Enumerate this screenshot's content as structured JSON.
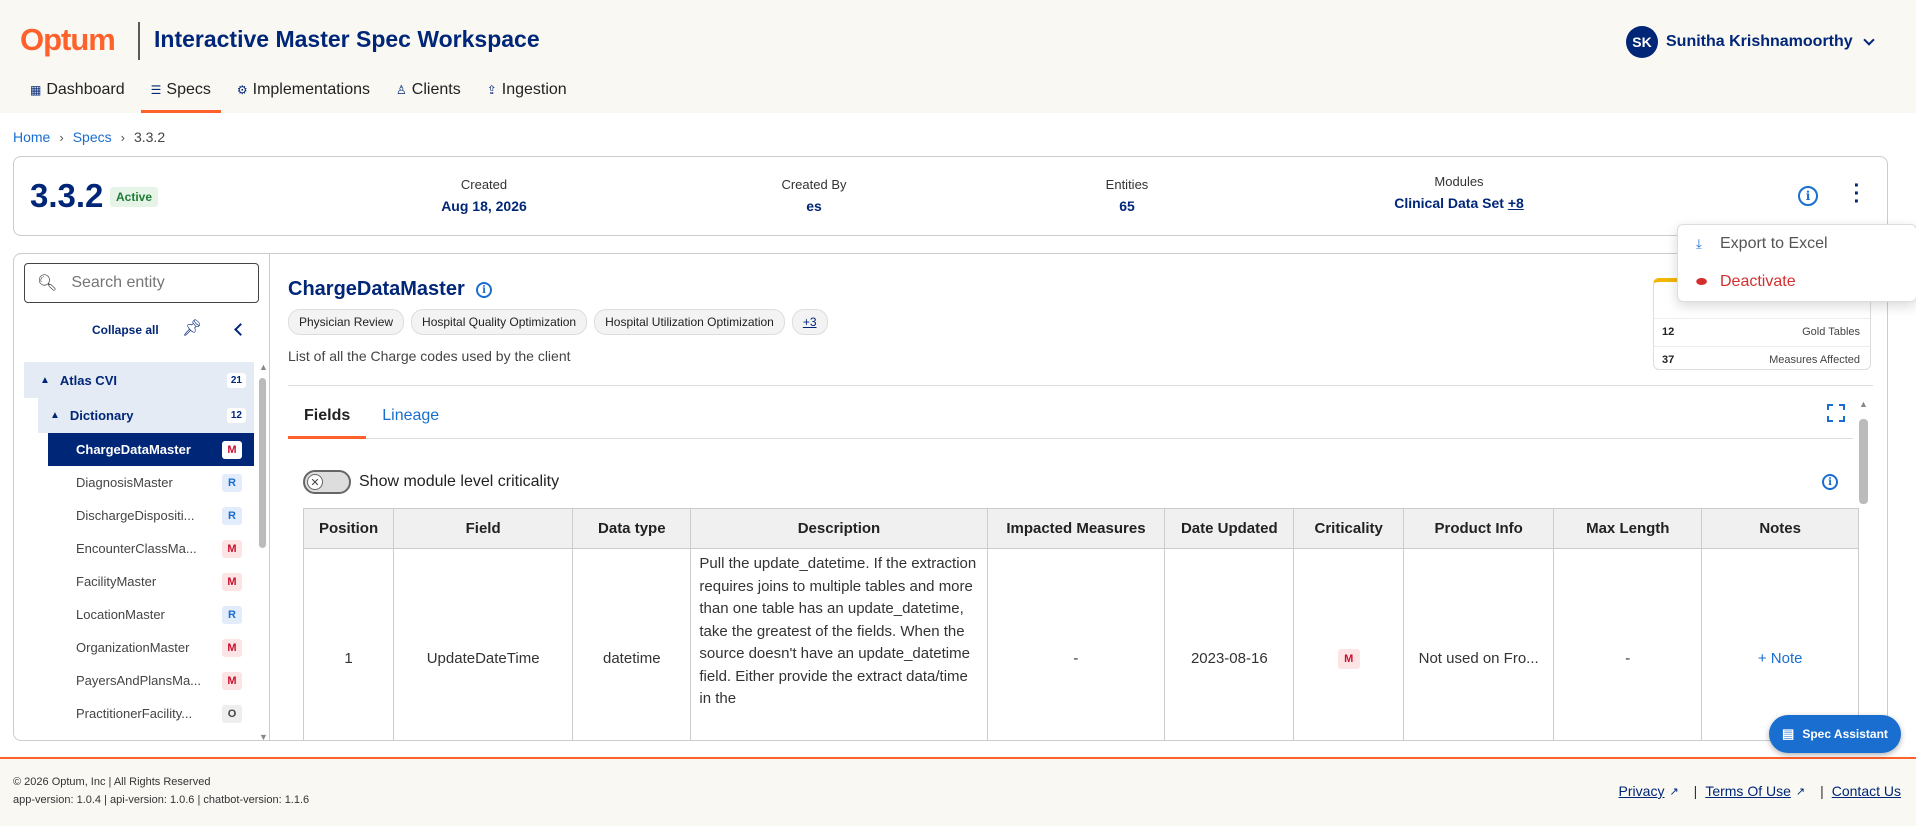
{
  "header": {
    "logo": "Optum",
    "app_title": "Interactive Master Spec Workspace",
    "user": {
      "initials": "SK",
      "name": "Sunitha Krishnamoorthy"
    }
  },
  "nav": {
    "items": [
      {
        "label": "Dashboard",
        "icon": "dashboard-icon"
      },
      {
        "label": "Specs",
        "icon": "database-icon",
        "active": true
      },
      {
        "label": "Implementations",
        "icon": "gear-icon"
      },
      {
        "label": "Clients",
        "icon": "user-icon"
      },
      {
        "label": "Ingestion",
        "icon": "upload-icon"
      }
    ]
  },
  "breadcrumb": [
    "Home",
    "Specs",
    "3.3.2"
  ],
  "spec": {
    "version": "3.3.2",
    "status": "Active",
    "created_label": "Created",
    "created_value": "Aug 18, 2026",
    "created_by_label": "Created By",
    "created_by_value": "es",
    "entities_label": "Entities",
    "entities_value": "65",
    "modules_label": "Modules",
    "modules_value": "Clinical Data Set",
    "modules_more": "+8"
  },
  "menu": {
    "export": "Export to Excel",
    "deactivate": "Deactivate"
  },
  "sidebar": {
    "search_placeholder": "Search entity",
    "collapse_label": "Collapse all",
    "group": {
      "label": "Atlas CVI",
      "count": "21"
    },
    "subgroup": {
      "label": "Dictionary",
      "count": "12"
    },
    "items": [
      {
        "label": "ChargeDataMaster",
        "badge": "M"
      },
      {
        "label": "DiagnosisMaster",
        "badge": "R"
      },
      {
        "label": "DischargeDispositi...",
        "badge": "R"
      },
      {
        "label": "EncounterClassMa...",
        "badge": "M"
      },
      {
        "label": "FacilityMaster",
        "badge": "M"
      },
      {
        "label": "LocationMaster",
        "badge": "R"
      },
      {
        "label": "OrganizationMaster",
        "badge": "M"
      },
      {
        "label": "PayersAndPlansMa...",
        "badge": "M"
      },
      {
        "label": "PractitionerFacility...",
        "badge": "O"
      }
    ]
  },
  "entity": {
    "name": "ChargeDataMaster",
    "tags": [
      "Physician Review",
      "Hospital Quality Optimization",
      "Hospital Utilization Optimization"
    ],
    "tags_more": "+3",
    "description": "List of all the Charge codes used by the client",
    "stats": [
      {
        "value": "12",
        "label": "Gold Tables"
      },
      {
        "value": "37",
        "label": "Measures Affected"
      }
    ]
  },
  "tabs": [
    "Fields",
    "Lineage"
  ],
  "toggle_label": "Show module level criticality",
  "table": {
    "columns": [
      "Position",
      "Field",
      "Data type",
      "Description",
      "Impacted Measures",
      "Date Updated",
      "Criticality",
      "Product Info",
      "Max Length",
      "Notes"
    ],
    "rows": [
      {
        "position": "1",
        "field": "UpdateDateTime",
        "datatype": "datetime",
        "description": "Pull the update_datetime.  If the extraction requires joins to multiple tables and more than one table has an update_datetime, take the greatest of the fields. When the source doesn't have an update_datetime field. Either provide the extract data/time in the",
        "impacted": "-",
        "date": "2023-08-16",
        "criticality": "M",
        "product_info": "Not used on Fro...",
        "max_length": "-",
        "notes": "+ Note"
      }
    ]
  },
  "assistant_label": "Spec Assistant",
  "footer": {
    "copyright": "© 2026 Optum, Inc | All Rights Reserved",
    "versions": "app-version: 1.0.4 | api-version: 1.0.6 | chatbot-version: 1.1.6",
    "privacy": "Privacy",
    "terms": "Terms Of Use",
    "contact": "Contact Us"
  },
  "colors": {
    "brand_orange": "#ff612b",
    "brand_navy": "#002677",
    "link_blue": "#196ecf"
  }
}
